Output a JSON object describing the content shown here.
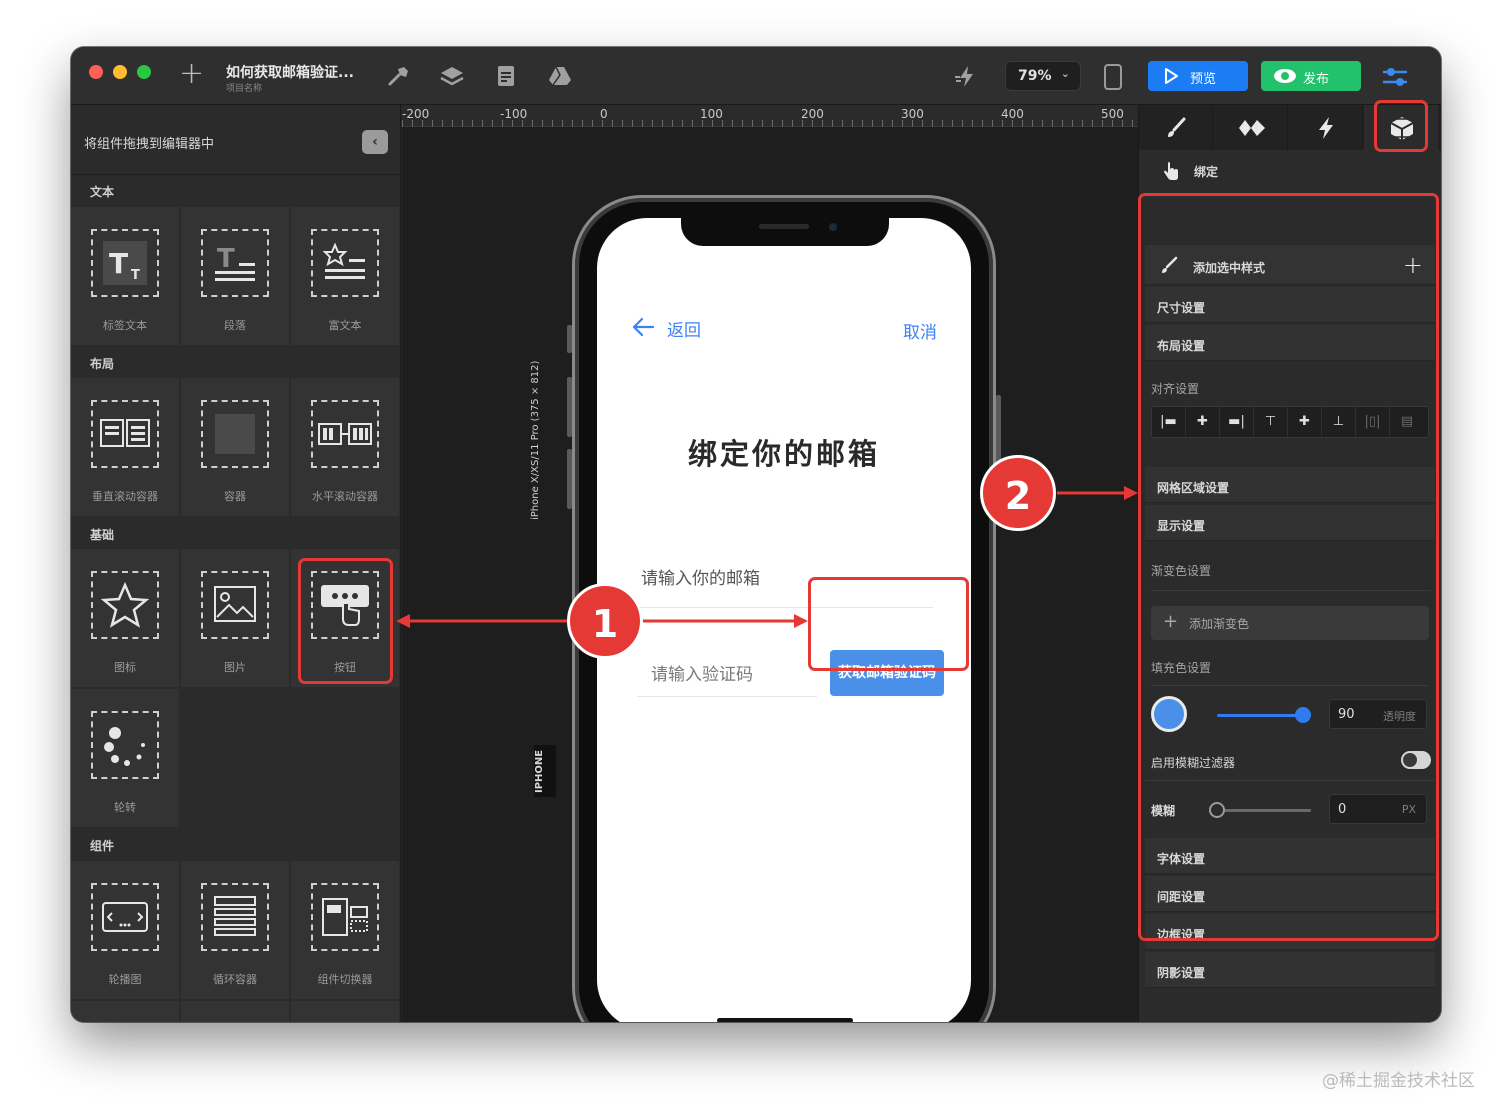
{
  "titlebar": {
    "project_name": "如何获取邮箱验证...",
    "project_sub": "项目名称",
    "zoom": "79%",
    "preview_label": "预览",
    "publish_label": "发布"
  },
  "left_panel": {
    "header": "将组件拖拽到编辑器中",
    "sections": {
      "text": "文本",
      "layout": "布局",
      "basic": "基础",
      "components": "组件"
    },
    "tiles": {
      "label_text": "标签文本",
      "paragraph": "段落",
      "rich_text": "富文本",
      "vscroll": "垂直滚动容器",
      "container": "容器",
      "hscroll": "水平滚动容器",
      "icon": "图标",
      "image": "图片",
      "button": "按钮",
      "spinner": "轮转",
      "carousel": "轮播图",
      "loop": "循环容器",
      "switcher": "组件切换器"
    }
  },
  "canvas": {
    "ruler": [
      "-200",
      "-100",
      "0",
      "100",
      "200",
      "300",
      "400",
      "500"
    ],
    "device_size": "iPhone X/XS/11 Pro (375 × 812)",
    "device_tag": "IPHONE",
    "app": {
      "back": "返回",
      "cancel": "取消",
      "title": "绑定你的邮箱",
      "email_placeholder": "请输入你的邮箱",
      "code_placeholder": "请输入验证码",
      "get_code_button": "获取邮箱验证码"
    }
  },
  "right_panel": {
    "bind_label": "绑定",
    "add_style": "添加选中样式",
    "size": "尺寸设置",
    "layout": "布局设置",
    "align": "对齐设置",
    "grid": "网格区域设置",
    "display": "显示设置",
    "gradient": "渐变色设置",
    "add_gradient": "添加渐变色",
    "fill": "填充色设置",
    "fill_value": "90",
    "fill_unit": "透明度",
    "fill_opacity": 0.9,
    "blur_enable": "启用模糊过滤器",
    "blur": "模糊",
    "blur_value": "0",
    "blur_unit": "PX",
    "font": "字体设置",
    "spacing": "间距设置",
    "border": "边框设置",
    "shadow": "阴影设置"
  },
  "annotations": {
    "marker_1": "1",
    "marker_2": "2"
  },
  "watermark": "@稀土掘金技术社区",
  "colors": {
    "accent_blue": "#1c7cf4",
    "publish_green": "#22c16b",
    "annotation_red": "#e53935",
    "fill_color": "#4a8fe8"
  }
}
